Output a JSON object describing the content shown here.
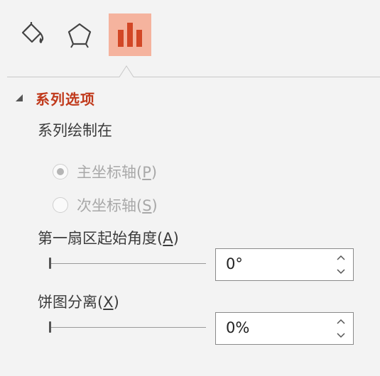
{
  "tabs": [
    {
      "name": "fill-line",
      "icon": "paint-bucket-icon",
      "active": false
    },
    {
      "name": "effects",
      "icon": "pentagon-icon",
      "active": false
    },
    {
      "name": "series-options",
      "icon": "bar-chart-icon",
      "active": true
    }
  ],
  "section": {
    "title": "系列选项",
    "expanded": true
  },
  "plot_on": {
    "label": "系列绘制在",
    "primary": {
      "prefix": "主坐标轴(",
      "key": "P",
      "suffix": ")",
      "selected": true,
      "disabled": true
    },
    "secondary": {
      "prefix": "次坐标轴(",
      "key": "S",
      "suffix": ")",
      "selected": false,
      "disabled": true
    }
  },
  "first_slice_angle": {
    "prefix": "第一扇区起始角度(",
    "key": "A",
    "suffix": ")",
    "value": "0°",
    "slider_level": 0
  },
  "pie_explosion": {
    "prefix": "饼图分离(",
    "key": "X",
    "suffix": ")",
    "value": "0%",
    "slider_level": 0
  },
  "colors": {
    "accent": "#c0391b",
    "active_tab": "#f5b39e",
    "icon": "#d24726"
  }
}
